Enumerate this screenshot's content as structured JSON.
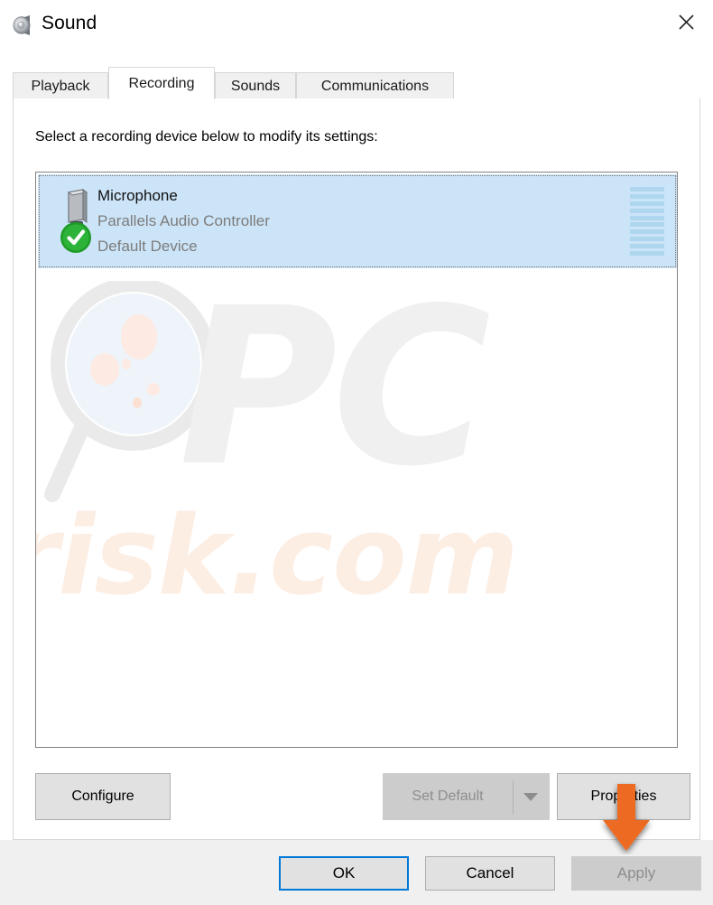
{
  "window": {
    "title": "Sound",
    "icon": "speaker-icon",
    "close_label": "✕"
  },
  "tabs": [
    {
      "label": "Playback",
      "active": false
    },
    {
      "label": "Recording",
      "active": true
    },
    {
      "label": "Sounds",
      "active": false
    },
    {
      "label": "Communications",
      "active": false
    }
  ],
  "panel": {
    "instruction": "Select a recording device below to modify its settings:"
  },
  "devices": [
    {
      "name": "Microphone",
      "driver": "Parallels Audio Controller",
      "status": "Default Device",
      "icon": "microphone-icon",
      "badge": "green-check-icon",
      "selected": true,
      "meter_segments": 10,
      "meter_level": 0
    }
  ],
  "action_buttons": {
    "configure": {
      "label": "Configure",
      "enabled": true
    },
    "set_default": {
      "label": "Set Default",
      "enabled": false
    },
    "set_default_dropdown": {
      "icon": "chevron-down-icon",
      "enabled": false
    },
    "properties": {
      "label": "Properties",
      "enabled": true
    }
  },
  "footer_buttons": {
    "ok": {
      "label": "OK",
      "enabled": true,
      "is_default": true
    },
    "cancel": {
      "label": "Cancel",
      "enabled": true
    },
    "apply": {
      "label": "Apply",
      "enabled": false
    }
  },
  "annotation": {
    "arrow": "orange-down-arrow",
    "points_at": "Properties",
    "color": "#ed6b20"
  },
  "watermark": {
    "text_primary": "PC",
    "text_secondary": "risk.com",
    "logo": "magnifying-glass-icon",
    "color_primary": "#f0f0f0",
    "color_secondary": "#fdeee4"
  },
  "colors": {
    "selection_blue": "#cce4f7",
    "meter_blue": "#aed7ef",
    "focus_blue": "#0078d7",
    "disabled_gray": "#8d8d8d",
    "panel_bg": "#ffffff",
    "footer_bg": "#f0f0f0"
  }
}
